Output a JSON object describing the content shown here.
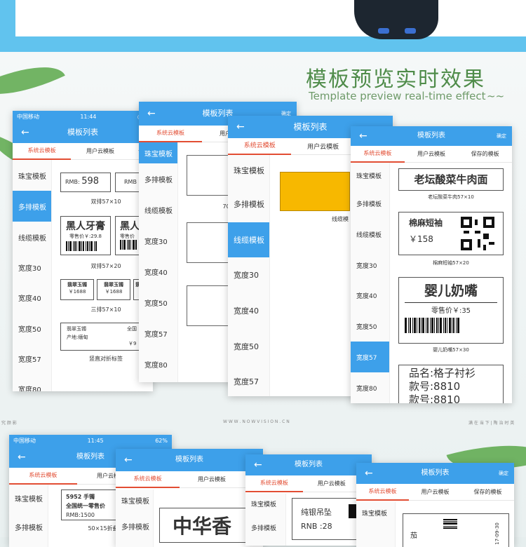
{
  "heading": {
    "title": "模板预览实时效果",
    "subtitle": "Template preview real-time effect",
    "tilde": "~~"
  },
  "footer": {
    "left": "究 颜 影",
    "center": "W W W . N O W V I S I O N . C N",
    "right": "满 在 当 下 | 陶 治 时 英"
  },
  "common": {
    "nav_title": "模板列表",
    "ok": "确定",
    "back": "←",
    "tab_sys": "系统云模板",
    "tab_user": "用户云模板",
    "tab_saved": "保存的模板",
    "tab_saved_short": "保"
  },
  "s1": {
    "status": {
      "carrier": "中国移动",
      "time": "11:44"
    },
    "side": [
      "珠宝模板",
      "多排模板",
      "线缆模板",
      "宽度30",
      "宽度40",
      "宽度50",
      "宽度57",
      "宽度80"
    ],
    "l1": {
      "rmb": "RMB:",
      "num": "598",
      "rmb2": "RMB",
      "cap": "双排57×10"
    },
    "l2": {
      "name": "黑人牙膏",
      "name2": "黑人",
      "price": "零售价￥:29.8",
      "price2": "零售价",
      "cap": "双排57×20"
    },
    "l3": {
      "name": "翡翠玉镯",
      "price": "￥1688",
      "cap": "三排57×10"
    },
    "l4": {
      "name": "翡翠玉镯",
      "place": "产地:缅甸",
      "cn": "全国",
      "price": "￥9",
      "cap": "竖直对折标签"
    }
  },
  "s2": {
    "side": [
      "珠宝模板",
      "多排模板",
      "线缆模板",
      "宽度30",
      "宽度40",
      "宽度50",
      "宽度57",
      "宽度80"
    ],
    "cap1": "70×"
  },
  "s3": {
    "side": [
      "珠宝模板",
      "多排模板",
      "线缆模板",
      "宽度30",
      "宽度40",
      "宽度50",
      "宽度57"
    ],
    "cap1": "线缆模"
  },
  "s4": {
    "side": [
      "珠宝模板",
      "多排模板",
      "线缆模板",
      "宽度30",
      "宽度40",
      "宽度50",
      "宽度57",
      "宽度80"
    ],
    "l1": {
      "title": "老坛酸菜牛肉面",
      "cap": "老坛酸菜牛肉57×10"
    },
    "l2": {
      "title": "棉麻短袖",
      "price": "￥158",
      "cap": "棉麻短袖57×20"
    },
    "l3": {
      "title": "婴儿奶嘴",
      "price": "零售价￥:35",
      "cap": "婴儿奶嘴57×30"
    },
    "l4": {
      "line1": "品名:格子衬衫",
      "line2": "款号:8810",
      "line3": "款号:8810"
    }
  },
  "b1": {
    "status": {
      "carrier": "中国移动",
      "time": "11:45",
      "battery": "62%"
    },
    "side": [
      "珠宝模板",
      "多排模板"
    ],
    "l1": {
      "code": "5952 手镯",
      "text": "全国统一零售价",
      "rmb": "RMB:1500",
      "cap": "50×15折叠"
    }
  },
  "b2": {
    "side": [
      "珠宝模板",
      "多排模板"
    ],
    "big": "中华香"
  },
  "b3": {
    "side": [
      "珠宝模板",
      "多排模板"
    ],
    "name": "纯银吊坠",
    "rnb": "RNB :28"
  },
  "b4": {
    "side": [
      "珠宝模板"
    ],
    "ch": "茄",
    "date": "17-09-30"
  }
}
